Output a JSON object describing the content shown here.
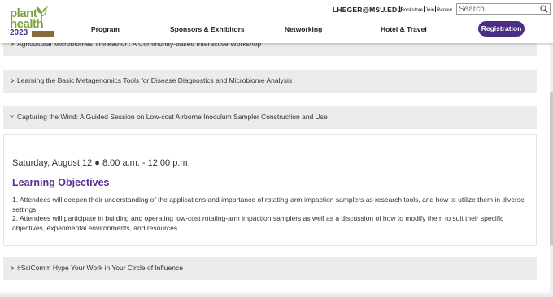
{
  "header": {
    "logo": {
      "line1": "plant",
      "line2": "health",
      "year": "2023"
    },
    "user_email": "LHEGER@MSU.EDU",
    "util_links": [
      "Bookstore",
      "Join",
      "Renew"
    ],
    "search": {
      "placeholder": "Search...",
      "icon": "search-icon"
    },
    "nav": [
      "Program",
      "Sponsors & Exhibitors",
      "Networking",
      "Hotel & Travel"
    ],
    "registration_label": "Registration"
  },
  "accordion": [
    {
      "title": "Agricultural Microbiomes Thinkathon: A Community-based Interactive Workshop",
      "expanded": false
    },
    {
      "title": "Learning the Basic Metagenomics Tools for Disease Diagnostics and Microbiome Analysis",
      "expanded": false
    },
    {
      "title": "Capturing the Wind: A Guided Session on Low-cost Airborne Inoculum Sampler Construction and Use",
      "expanded": true
    },
    {
      "title": "#SciComm Hype Your Work in Your Circle of Influence",
      "expanded": false
    }
  ],
  "session": {
    "date_time": "Saturday, August 12 ● 8:00 a.m. - 12:00 p.m.",
    "heading": "Learning Objectives",
    "objectives": [
      "1. Attendees will deepen their understanding of the applications and importance of rotating-arm impaction samplers as research tools, and how to utilize them in diverse settings.",
      "2. Attendees will participate in building and operating low-cost rotating-arm impaction samplers as well as a discussion of how to modify them to suit their specific objectives, experimental environments, and resources."
    ]
  },
  "colors": {
    "brand_purple": "#4b2e83",
    "heading_purple": "#5a2f92",
    "logo_green": "#7ba23f",
    "accordion_bg": "#ebebeb"
  }
}
